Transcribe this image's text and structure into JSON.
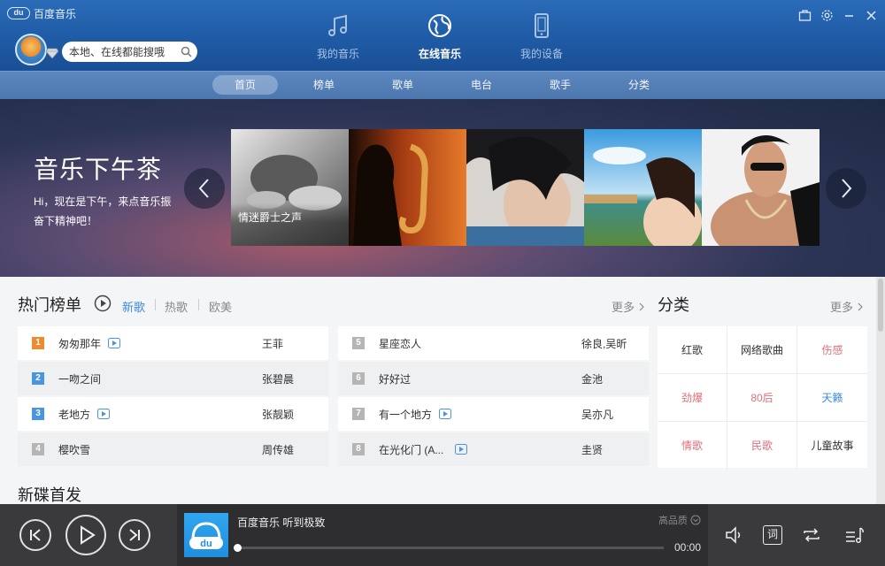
{
  "app": {
    "title": "百度音乐",
    "logo_text": "du"
  },
  "search": {
    "placeholder": "本地、在线都能搜哦"
  },
  "modes": [
    {
      "label": "我的音乐",
      "icon": "music-note-icon"
    },
    {
      "label": "在线音乐",
      "icon": "globe-icon",
      "active": true
    },
    {
      "label": "我的设备",
      "icon": "phone-device-icon"
    }
  ],
  "nav_tabs": [
    {
      "label": "首页",
      "active": true
    },
    {
      "label": "榜单"
    },
    {
      "label": "歌单"
    },
    {
      "label": "电台"
    },
    {
      "label": "歌手"
    },
    {
      "label": "分类"
    }
  ],
  "banner": {
    "title": "音乐下午茶",
    "description": "Hi，现在是下午，来点音乐振奋下精神吧！",
    "tile_caption": "情迷爵士之声"
  },
  "hot": {
    "title": "热门榜单",
    "tabs": [
      {
        "label": "新歌",
        "active": true
      },
      {
        "label": "热歌"
      },
      {
        "label": "欧美"
      }
    ],
    "more": "更多",
    "songs": [
      {
        "rank": "1",
        "name": "匆匆那年",
        "artist": "王菲",
        "mv": true
      },
      {
        "rank": "2",
        "name": "一吻之间",
        "artist": "张碧晨",
        "mv": false
      },
      {
        "rank": "3",
        "name": "老地方",
        "artist": "张靓颖",
        "mv": true
      },
      {
        "rank": "4",
        "name": "樱吹雪",
        "artist": "周传雄",
        "mv": false
      },
      {
        "rank": "5",
        "name": "星座恋人",
        "artist": "徐良,吴昕",
        "mv": false
      },
      {
        "rank": "6",
        "name": "好好过",
        "artist": "金池",
        "mv": false
      },
      {
        "rank": "7",
        "name": "有一个地方",
        "artist": "吴亦凡",
        "mv": true
      },
      {
        "rank": "8",
        "name": "在光化门 (A...",
        "artist": "圭贤",
        "mv": true
      }
    ]
  },
  "category": {
    "title": "分类",
    "more": "更多",
    "items": [
      {
        "label": "红歌",
        "color": "#333333"
      },
      {
        "label": "网络歌曲",
        "color": "#333333"
      },
      {
        "label": "伤感",
        "color": "#e0707a"
      },
      {
        "label": "劲爆",
        "color": "#e0707a"
      },
      {
        "label": "80后",
        "color": "#e0707a"
      },
      {
        "label": "天籁",
        "color": "#3d8be0"
      },
      {
        "label": "情歌",
        "color": "#e0707a"
      },
      {
        "label": "民歌",
        "color": "#e0707a"
      },
      {
        "label": "儿童故事",
        "color": "#333333"
      }
    ]
  },
  "new_releases": {
    "title": "新碟首发"
  },
  "player": {
    "now_playing": "百度音乐 听到极致",
    "quality": "高品质",
    "time": "00:00",
    "progress": 0,
    "lyrics_label": "词"
  },
  "colors": {
    "accent": "#3d8be0",
    "header": "#1f5ba5",
    "rank_top": "#f08a2c",
    "player_bg": "#3a3a3d"
  }
}
